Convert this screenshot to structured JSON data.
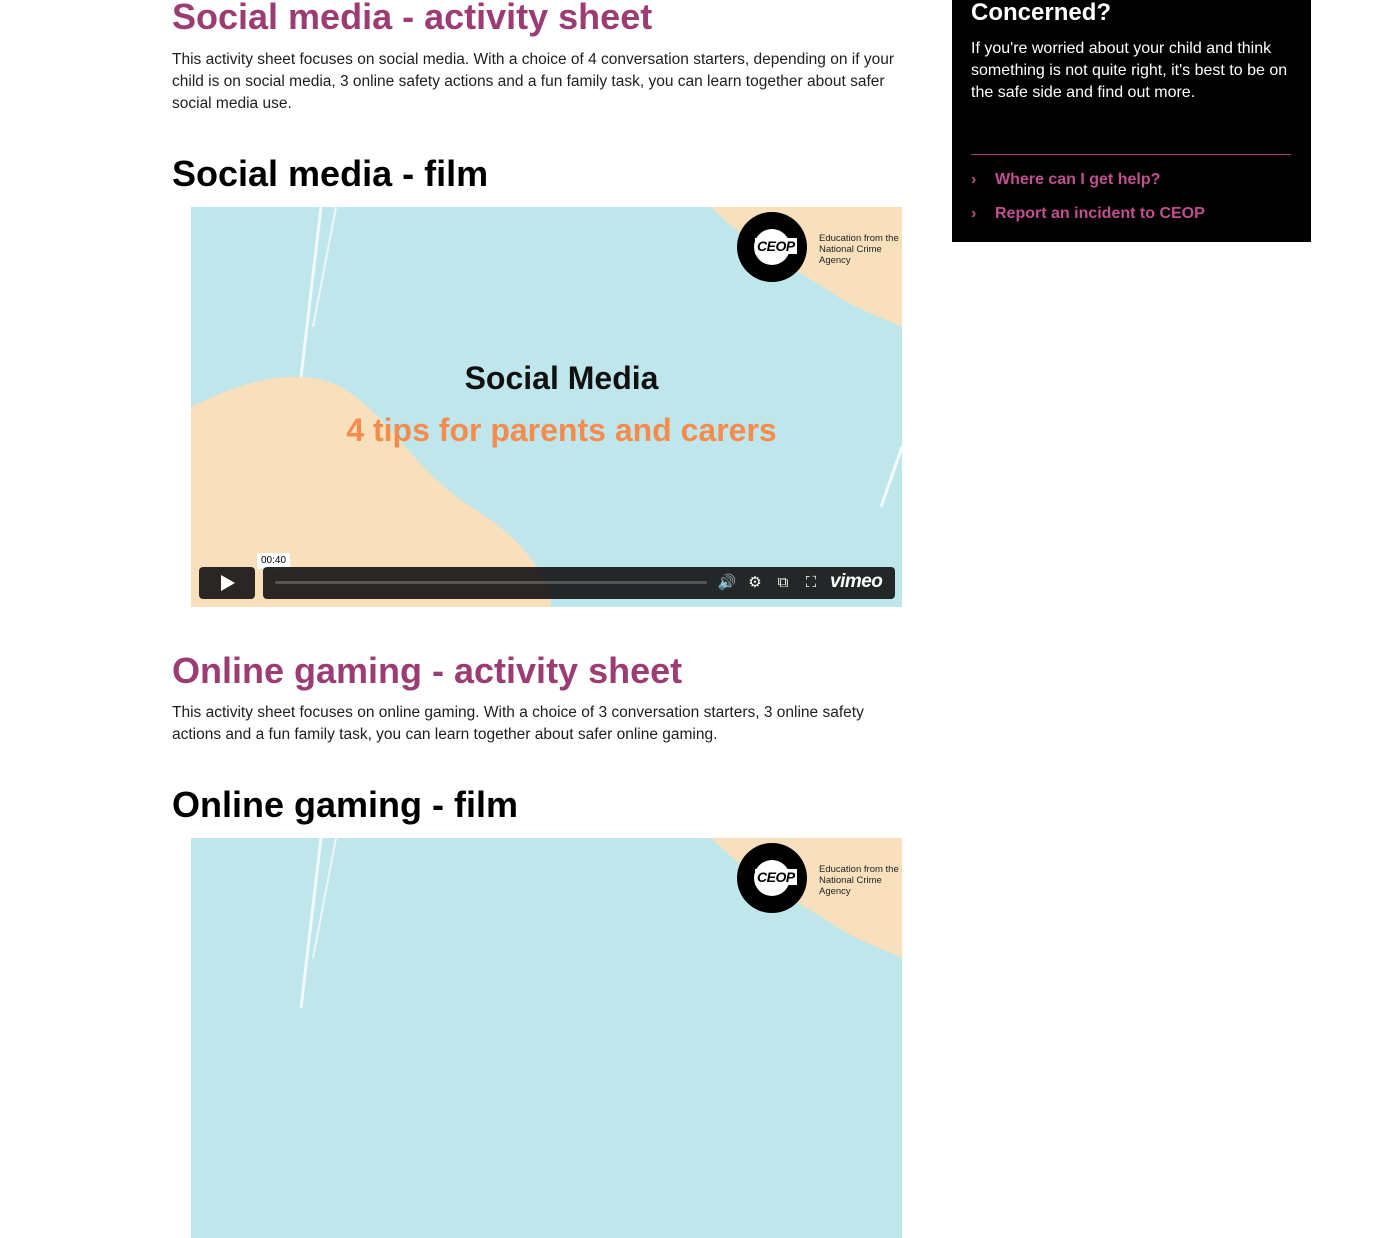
{
  "main": {
    "social_sheet": {
      "heading": "Social media - activity sheet",
      "text": "This activity sheet focuses on social media. With a choice of 4 conversation starters, depending on if your child is on social media, 3 online safety actions and a fun family task, you can learn together about safer social media use."
    },
    "social_film": {
      "heading": "Social media - film",
      "video": {
        "logo_text": "CEOP",
        "logo_caption": "Education from the National Crime Agency",
        "title": "Social Media",
        "subtitle": "4 tips for parents and carers",
        "time": "00:40",
        "progress": 0,
        "vimeo": "vimeo"
      }
    },
    "gaming_sheet": {
      "heading": "Online gaming - activity sheet",
      "text": "This activity sheet focuses on online gaming. With a choice of 3 conversation starters, 3 online safety actions and a fun family task, you can learn together about safer online gaming."
    },
    "gaming_film": {
      "heading": "Online gaming - film",
      "video": {
        "logo_text": "CEOP",
        "logo_caption": "Education from the National Crime Agency"
      }
    }
  },
  "sidebar": {
    "title": "Concerned?",
    "text": "If you're worried about your child and think something is not quite right, it's best to be on the safe side and find out more.",
    "links": [
      {
        "label": "Where can I get help?"
      },
      {
        "label": "Report an incident to CEOP"
      }
    ]
  },
  "colors": {
    "accent": "#9b3c73",
    "video_blue": "#bee6eb",
    "video_peach": "#f9e0bd",
    "subtitle_orange": "#f58b4c"
  }
}
